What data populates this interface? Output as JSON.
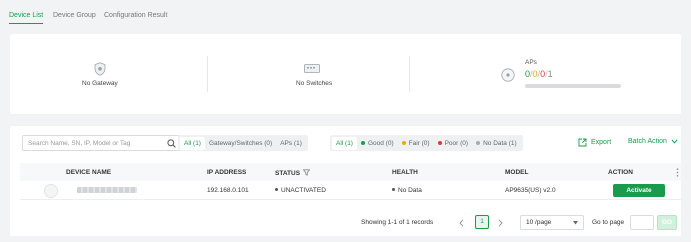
{
  "tabs": [
    "Device List",
    "Device Group",
    "Configuration Result"
  ],
  "summary": {
    "gateway_label": "No Gateway",
    "switches_label": "No Switches",
    "aps_title": "APs",
    "aps_counts": [
      "0",
      "0",
      "0",
      "1"
    ],
    "aps_count_colors": [
      "#1a9a4c",
      "#e6a817",
      "#e0393e",
      "#888888"
    ],
    "aps_sep": "/"
  },
  "toolbar": {
    "search_placeholder": "Search Name, SN, IP, Model or Tag",
    "type_filters": [
      "All (1)",
      "Gateway/Switches (0)",
      "APs (1)"
    ],
    "health_filters": [
      {
        "label": "All (1)",
        "color": ""
      },
      {
        "label": "Good (0)",
        "color": "#1a9a4c"
      },
      {
        "label": "Fair (0)",
        "color": "#e6a817"
      },
      {
        "label": "Poor (0)",
        "color": "#e0393e"
      },
      {
        "label": "No Data (1)",
        "color": "#aaaaaa"
      }
    ],
    "export_label": "Export",
    "batch_label": "Batch Action"
  },
  "table": {
    "headers": [
      "DEVICE NAME",
      "IP ADDRESS",
      "STATUS",
      "HEALTH",
      "MODEL",
      "ACTION"
    ],
    "rows": [
      {
        "ip": "192.168.0.101",
        "status": "UNACTIVATED",
        "health": "No Data",
        "model": "AP9635(US) v2.0",
        "action": "Activate"
      }
    ]
  },
  "pagination": {
    "showing": "Showing 1-1 of 1 records",
    "page": "1",
    "per_page": "10 /page",
    "goto_label": "Go to page",
    "go": "GO"
  },
  "colors": {
    "accent": "#1a9a4c",
    "background": "#f2f3f5"
  },
  "icons": [
    "gateway-shield-icon",
    "switch-icon",
    "ap-icon",
    "search-icon",
    "filter-icon",
    "export-icon",
    "chevron-down-icon",
    "more-icon",
    "chevron-left-icon",
    "chevron-right-icon"
  ]
}
